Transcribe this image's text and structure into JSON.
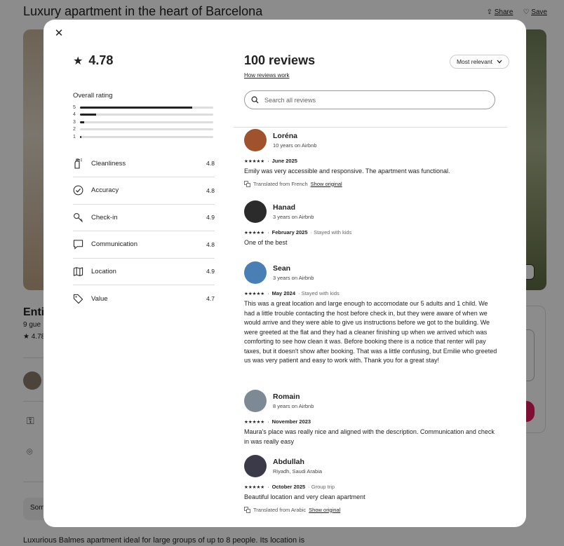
{
  "page": {
    "title": "Luxury apartment in the heart of Barcelona",
    "share_label": "Share",
    "save_label": "Save",
    "entire_label": "Enti",
    "guests_label": "9 gue",
    "rating_label": "★ 4.78",
    "some_label": "Som",
    "bottom_text": "Luxurious Balmes apartment ideal for large groups of up to 8 people. Its location is"
  },
  "modal": {
    "close_icon": "close-icon",
    "overall_score": "4.78",
    "overall_title": "Overall rating",
    "rating_bars": [
      {
        "label": "5",
        "fraction": 0.84
      },
      {
        "label": "4",
        "fraction": 0.12
      },
      {
        "label": "3",
        "fraction": 0.03
      },
      {
        "label": "2",
        "fraction": 0.0
      },
      {
        "label": "1",
        "fraction": 0.01
      }
    ],
    "categories": [
      {
        "label": "Cleanliness",
        "value": "4.8",
        "icon": "spray-bottle-icon"
      },
      {
        "label": "Accuracy",
        "value": "4.8",
        "icon": "check-circle-icon"
      },
      {
        "label": "Check-in",
        "value": "4.9",
        "icon": "key-icon"
      },
      {
        "label": "Communication",
        "value": "4.8",
        "icon": "message-icon"
      },
      {
        "label": "Location",
        "value": "4.9",
        "icon": "map-icon"
      },
      {
        "label": "Value",
        "value": "4.7",
        "icon": "tag-icon"
      }
    ],
    "reviews_count": "100 reviews",
    "how_reviews_work": "How reviews work",
    "sort_label": "Most relevant",
    "search_placeholder": "Search all reviews",
    "reviews": [
      {
        "name": "Loréna",
        "meta": "10 years on Airbnb",
        "stars": "★★★★★",
        "date": "June 2025",
        "extra": "",
        "text": "Emily was very accessible and responsive. The apartment was functional.",
        "translated": "Translated from French",
        "show_original": "Show original",
        "avatar_color": "#a0522d"
      },
      {
        "name": "Hanad",
        "meta": "3 years on Airbnb",
        "stars": "★★★★★",
        "date": "February 2025",
        "extra": "· Stayed with kids",
        "text": "One of the best",
        "translated": "",
        "show_original": "",
        "avatar_color": "#2b2b2b"
      },
      {
        "name": "Sean",
        "meta": "3 years on Airbnb",
        "stars": "★★★★★",
        "date": "May 2024",
        "extra": "· Stayed with kids",
        "text": "This was a great location and large enough to accomodate our 5 adults and 1 child. We had a little trouble contacting the host before check in, but they were aware of when we would arrive and they were able to give us instructions before we got to the building. We were greeted at the flat and they had a cleaner finishing up when we arrived which was comforting to see how clean it was. Before booking there is a notice that renter will pay taxes, but it doesn't show after booking. That was a little confusing, but Emilie who greeted us was very patient and easy to work with. Thank you for a great stay!",
        "translated": "",
        "show_original": "",
        "avatar_color": "#4a7fb5"
      },
      {
        "name": "Romain",
        "meta": "8 years on Airbnb",
        "stars": "★★★★★",
        "date": "November 2023",
        "extra": "",
        "text": "Maura's place was really nice and aligned with the description. Communication and check in was really easy",
        "translated": "",
        "show_original": "",
        "avatar_color": "#7d8a96"
      },
      {
        "name": "Abdullah",
        "meta": "Riyadh, Saudi Arabia",
        "stars": "★★★★★",
        "date": "October 2025",
        "extra": "· Group trip",
        "text": "Beautiful location and very clean apartment",
        "translated": "Translated from Arabic",
        "show_original": "Show original",
        "avatar_color": "#3a3a48"
      }
    ]
  }
}
